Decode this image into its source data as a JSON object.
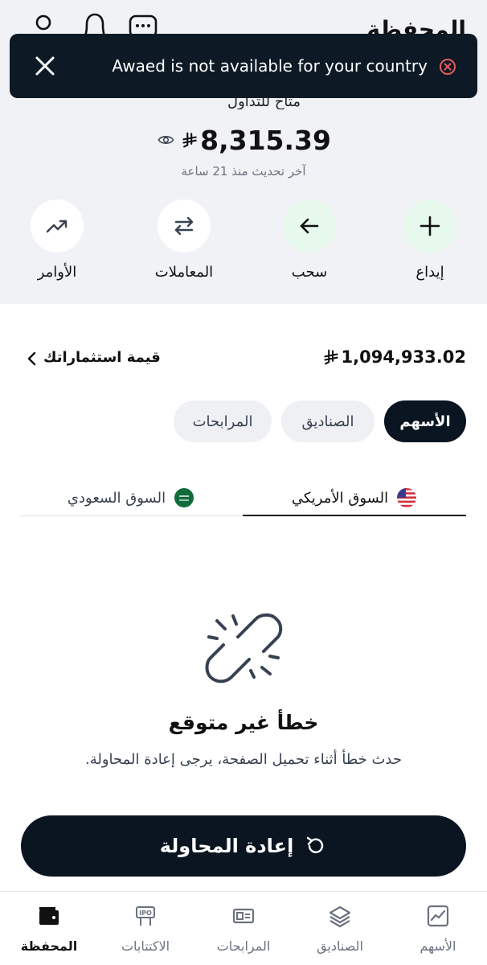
{
  "header": {
    "title": "المحفظة"
  },
  "toast": {
    "message": "Awaed is not available for your country"
  },
  "wallet": {
    "account_label": "متاح للتداول",
    "balance": "8,315.39",
    "last_updated": "آخر تحديث منذ 21 ساعة"
  },
  "actions": [
    {
      "label": "إيداع",
      "icon": "plus-icon"
    },
    {
      "label": "سحب",
      "icon": "arrow-left-icon"
    },
    {
      "label": "المعاملات",
      "icon": "swap-icon"
    },
    {
      "label": "الأوامر",
      "icon": "trending-up-icon"
    }
  ],
  "investments": {
    "label": "قيمة استثماراتك",
    "amount": "1,094,933.02"
  },
  "category_tabs": [
    {
      "label": "الأسهم",
      "selected": true
    },
    {
      "label": "الصناديق",
      "selected": false
    },
    {
      "label": "المرابحات",
      "selected": false
    }
  ],
  "market_tabs": [
    {
      "label": "السوق الأمريكي",
      "selected": true,
      "flag": "us-flag-icon"
    },
    {
      "label": "السوق السعودي",
      "selected": false,
      "flag": "saudi-flag-icon"
    }
  ],
  "error": {
    "title": "خطأ غير متوقع",
    "message": "حدث خطأ أثناء تحميل الصفحة، يرجى إعادة المحاولة."
  },
  "retry": {
    "label": "إعادة المحاولة"
  },
  "bottom_nav": [
    {
      "label": "الأسهم",
      "icon": "chart-icon",
      "active": false
    },
    {
      "label": "الصناديق",
      "icon": "layers-icon",
      "active": false
    },
    {
      "label": "المرابحات",
      "icon": "murabaha-icon",
      "active": false
    },
    {
      "label": "الاكتتابات",
      "icon": "ipo-icon",
      "active": false
    },
    {
      "label": "المحفظة",
      "icon": "wallet-icon",
      "active": true
    }
  ],
  "colors": {
    "dark": "#0a1521",
    "top_bg": "#f0f2f5",
    "accent_green_bg": "#e6f9ec",
    "error_red": "#e85a5a"
  }
}
